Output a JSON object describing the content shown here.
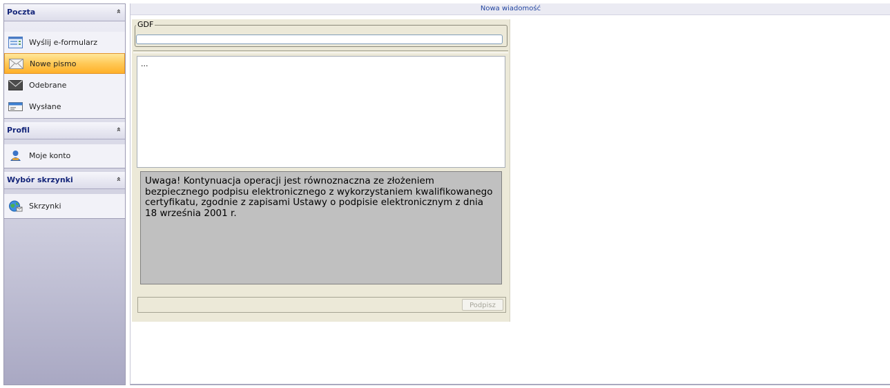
{
  "sidebar": {
    "sections": [
      {
        "title": "Poczta",
        "items": [
          {
            "label": "Wyślij e-formularz",
            "icon": "form-icon"
          },
          {
            "label": "Nowe pismo",
            "icon": "new-letter-icon",
            "active": true
          },
          {
            "label": "Odebrane",
            "icon": "inbox-envelope-icon"
          },
          {
            "label": "Wysłane",
            "icon": "sent-card-icon"
          }
        ]
      },
      {
        "title": "Profil",
        "items": [
          {
            "label": "Moje konto",
            "icon": "account-person-icon"
          }
        ]
      },
      {
        "title": "Wybór skrzynki",
        "items": [
          {
            "label": "Skrzynki",
            "icon": "globe-mailbox-icon"
          }
        ]
      }
    ],
    "collapse_glyph": "≈"
  },
  "main": {
    "title": "Nowa wiadomość",
    "form": {
      "gdf_legend": "GDF",
      "gdf_value": "",
      "message_text": "...",
      "warning_text": "Uwaga! Kontynuacja operacji jest równoznaczna ze złożeniem bezpiecznego podpisu elektronicznego z wykorzystaniem kwalifikowanego certyfikatu, zgodnie z zapisami Ustawy o podpisie elektronicznym z dnia 18 września 2001 r.",
      "sign_label": "Podpisz",
      "status_text": ""
    }
  },
  "colors": {
    "active_item": "#ffc957",
    "section_title": "#15267a",
    "panel_bg": "#ece9d8",
    "warning_bg": "#c0c0c0"
  }
}
